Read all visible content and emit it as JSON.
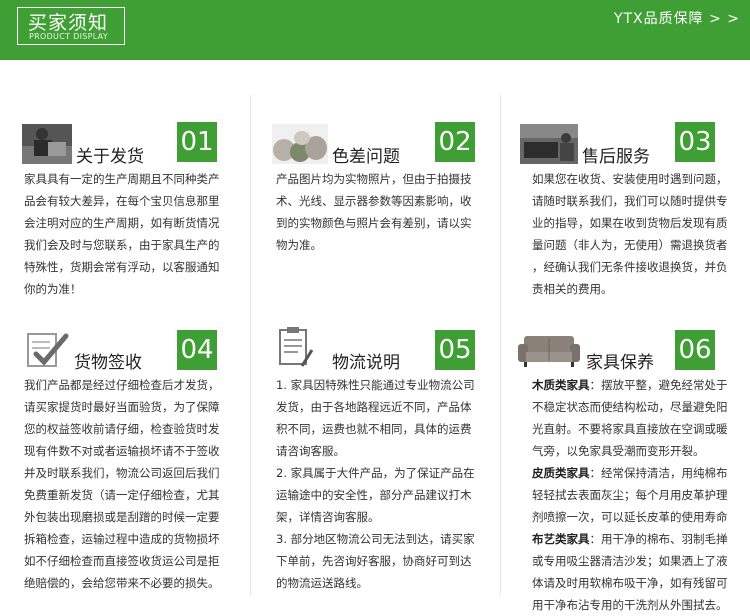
{
  "header": {
    "title": "买家须知",
    "subtitle": "PRODUCT DISPLAY",
    "right_link": "YTX品质保障 > >"
  },
  "colors": {
    "accent": "#3f9f34"
  },
  "cards": [
    {
      "icon": "delivery-worker-photo",
      "title": "关于发货",
      "num": "01",
      "lines": [
        "家具具有一定的生产周期且不同种类产",
        "品会有较大差异，在每个宝贝信息那里",
        "会注明对应的生产周期，如有断货情况",
        "我们会及时与您联系，由于家具生产的",
        "特殊性，货期会常有浮动，以客服通知",
        "你的为准！"
      ]
    },
    {
      "icon": "color-fabric-photo",
      "title": "色差问题",
      "num": "02",
      "lines": [
        "产品图片均为实物照片，但由于拍摄技",
        "术、光线、显示器参数等因素影响，收",
        "到的实物颜色与照片会有差别，请以实",
        "物为准。"
      ]
    },
    {
      "icon": "service-sofa-photo",
      "title": "售后服务",
      "num": "03",
      "lines": [
        "如果您在收货、安装使用时遇到问题，",
        "请随时联系我们，我们可以随时提供专",
        "业的指导，如果在收到货物后发现有质",
        "量问题（非人为，无使用）需退换货者",
        "，经确认我们无条件接收退换货，并负",
        "责相关的费用。"
      ]
    },
    {
      "icon": "checklist-icon",
      "title": "货物签收",
      "num": "04",
      "lines": [
        "我们产品都是经过仔细检查后才发货，",
        "请买家提货时最好当面验货，为了保障",
        "您的权益签收前请仔细，检查验货时发",
        "现有件数不对或者运输损坏请不于签收",
        "并及时联系我们，物流公司返回后我们",
        "免费重新发货（请一定仔细检查，尤其",
        "外包装出现磨损或是刮蹭的时候一定要",
        "拆箱检查，运输过程中造成的货物损坏",
        "如不仔细检查而直接签收货运公司是拒",
        "绝赔偿的，会给您带来不必要的损失。"
      ]
    },
    {
      "icon": "clipboard-icon",
      "title": "物流说明",
      "num": "05",
      "lines": [
        "1. 家具因特殊性只能通过专业物流公司",
        "发货，由于各地路程远近不同，产品体",
        "积不同，运费也就不相同，具体的运费",
        "请咨询客服。",
        "2. 家具属于大件产品，为了保证产品在",
        "运输途中的安全性，部分产品建议打木",
        "架，详情咨询客服。",
        "3. 部分地区物流公司无法到达，请买家",
        "下单前，先咨询好客服，协商好可到达",
        "的物流运送路线。"
      ]
    },
    {
      "icon": "sofa-icon",
      "title": "家具保养",
      "num": "06",
      "lines": [
        "木质类家具：摆放平整，避免经常处于",
        "不稳定状态而使结构松动，尽量避免阳",
        "光直射。不要将家具直接放在空调或暖",
        "气旁，以免家具受潮而变形开裂。",
        "皮质类家具：经常保持清洁，用纯棉布",
        "轻轻拭去表面灰尘；每个月用皮革护理",
        "剂喷擦一次，可以延长皮革的使用寿命",
        "布艺类家具：用干净的棉布、羽制毛掸",
        "或专用吸尘器清洁沙发；如果洒上了液",
        "体请及时用软棉布吸干净，如有残留可",
        "用干净布沾专用的干洗剂从外围拭去。"
      ]
    }
  ]
}
